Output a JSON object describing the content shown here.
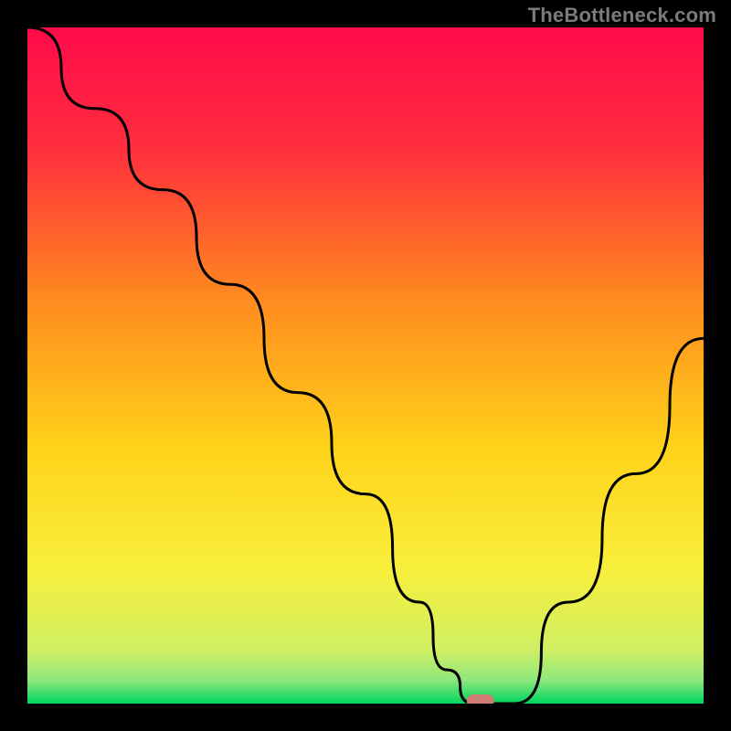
{
  "watermark": "TheBottleneck.com",
  "chart_data": {
    "type": "line",
    "title": "",
    "xlabel": "",
    "ylabel": "",
    "xlim": [
      0,
      100
    ],
    "ylim": [
      0,
      100
    ],
    "x": [
      0,
      10,
      20,
      30,
      40,
      50,
      58,
      62,
      66,
      68,
      72,
      80,
      90,
      100
    ],
    "values": [
      100,
      88,
      76,
      62,
      46,
      31,
      15,
      5,
      0,
      0,
      0,
      15,
      34,
      54
    ],
    "minimum_marker": {
      "x": 67,
      "value": 0
    },
    "gradient_stops": [
      {
        "pos": 0.0,
        "color": "#ff0a4a"
      },
      {
        "pos": 0.18,
        "color": "#ff2e3d"
      },
      {
        "pos": 0.4,
        "color": "#ff8a1f"
      },
      {
        "pos": 0.62,
        "color": "#ffd21a"
      },
      {
        "pos": 0.8,
        "color": "#f8ef3b"
      },
      {
        "pos": 0.92,
        "color": "#d0ef63"
      },
      {
        "pos": 0.965,
        "color": "#8fe77e"
      },
      {
        "pos": 1.0,
        "color": "#00d65e"
      }
    ]
  }
}
